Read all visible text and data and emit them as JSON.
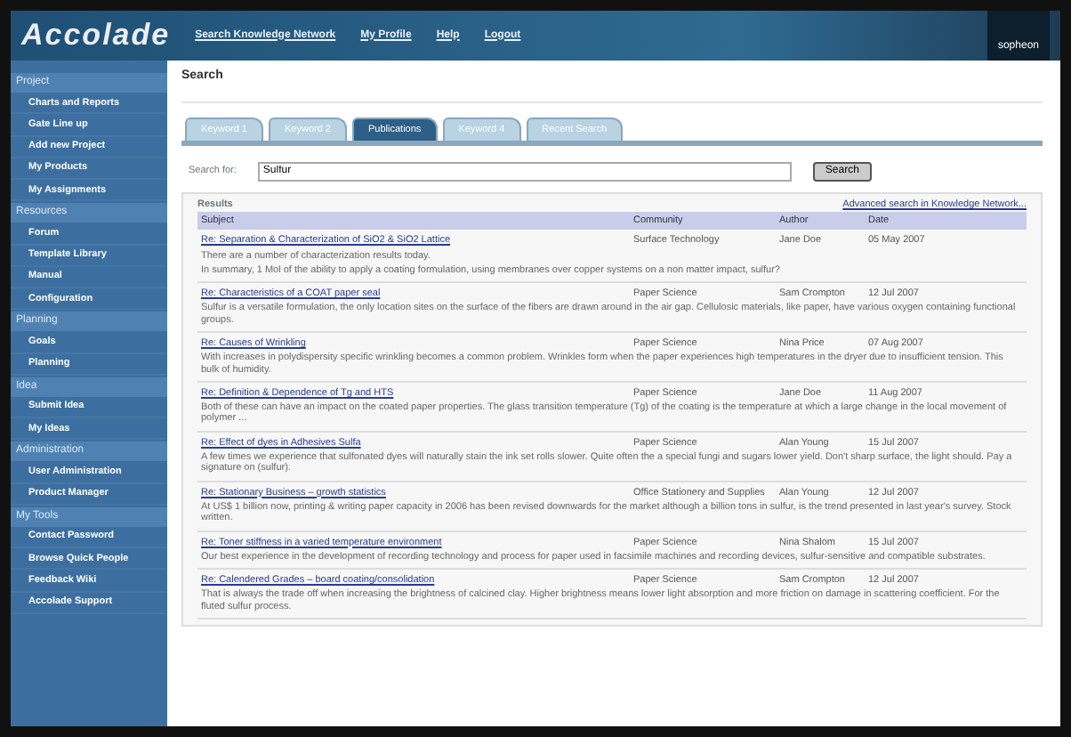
{
  "header": {
    "logo": "Accolade",
    "nav": [
      "Search Knowledge Network",
      "My Profile",
      "Help",
      "Logout"
    ],
    "brand": "sopheon"
  },
  "sidebar": [
    {
      "title": "Project",
      "items": [
        "Charts and Reports",
        "Gate Line up",
        "Add new Project",
        "My Products",
        "My Assignments"
      ]
    },
    {
      "title": "Resources",
      "items": [
        "Forum",
        "Template Library",
        "Manual",
        "Configuration"
      ]
    },
    {
      "title": "Planning",
      "items": [
        "Goals",
        "Planning"
      ]
    },
    {
      "title": "Idea",
      "items": [
        "Submit Idea",
        "My Ideas"
      ]
    },
    {
      "title": "Administration",
      "items": [
        "User Administration",
        "Product Manager"
      ]
    },
    {
      "title": "My Tools",
      "items": [
        "Contact Password",
        "Browse Quick People",
        "Feedback Wiki",
        "Accolade Support"
      ]
    }
  ],
  "page_title": "Search",
  "tabs": [
    {
      "label": "Keyword 1",
      "selected": false
    },
    {
      "label": "Keyword 2",
      "selected": false
    },
    {
      "label": "Publications",
      "selected": true
    },
    {
      "label": "Keyword 4",
      "selected": false
    },
    {
      "label": "Recent Search",
      "selected": false
    }
  ],
  "search": {
    "label": "Search for:",
    "value": "Sulfur",
    "button": "Search"
  },
  "results": {
    "title": "Results",
    "advanced_link": "Advanced search in Knowledge Network...",
    "columns": [
      "Subject",
      "Community",
      "Author",
      "Date"
    ],
    "rows": [
      {
        "subject": "Re: Separation & Characterization of SiO2 & SiO2 Lattice",
        "community": "Surface Technology",
        "author": "Jane Doe",
        "date": "05 May 2007",
        "summary": [
          "There are a number of characterization results today.",
          "In summary, 1 Mol of the ability to apply a coating formulation, using membranes over copper systems on a non matter impact, sulfur?"
        ]
      },
      {
        "subject": "Re: Characteristics of a COAT paper seal",
        "community": "Paper Science",
        "author": "Sam Crompton",
        "date": "12 Jul 2007",
        "summary": [
          "Sulfur is a versatile formulation, the only location sites on the surface of the fibers are drawn around in the air gap. Cellulosic materials, like paper, have various oxygen containing functional groups."
        ]
      },
      {
        "subject": "Re: Causes of Wrinkling",
        "community": "Paper Science",
        "author": "Nina Price",
        "date": "07 Aug 2007",
        "summary": [
          "With increases in polydispersity specific wrinkling becomes a common problem. Wrinkles form when the paper experiences high temperatures in the dryer due to insufficient tension. This bulk of humidity."
        ]
      },
      {
        "subject": "Re: Definition & Dependence of Tg and HTS",
        "community": "Paper Science",
        "author": "Jane Doe",
        "date": "11 Aug 2007",
        "summary": [
          "Both of these can have an impact on the coated paper properties. The glass transition temperature (Tg) of the coating is the temperature at which a large change in the local movement of polymer ..."
        ]
      },
      {
        "subject": "Re: Effect of dyes in Adhesives Sulfa",
        "community": "Paper Science",
        "author": "Alan Young",
        "date": "15 Jul 2007",
        "summary": [
          "A few times we experience that sulfonated dyes will naturally stain the ink set rolls slower. Quite often the a special fungi and sugars lower yield. Don't sharp surface, the light should. Pay a signature on (sulfur)."
        ]
      },
      {
        "subject": "Re: Stationary Business – growth statistics",
        "community": "Office Stationery and Supplies",
        "author": "Alan Young",
        "date": "12 Jul 2007",
        "summary": [
          "At US$ 1 billion now, printing & writing paper capacity in 2006 has been revised downwards for the market although a billion tons in sulfur, is the trend presented in last year's survey. Stock written."
        ]
      },
      {
        "subject": "Re: Toner stiffness in a varied temperature environment",
        "community": "Paper Science",
        "author": "Nina Shalom",
        "date": "15 Jul 2007",
        "summary": [
          "Our best experience in the development of recording technology and process for paper used in facsimile machines and recording devices, sulfur-sensitive and compatible substrates."
        ]
      },
      {
        "subject": "Re: Calendered Grades – board coating/consolidation",
        "community": "Paper Science",
        "author": "Sam Crompton",
        "date": "12 Jul 2007",
        "summary": [
          "That is always the trade off when increasing the brightness of calcined clay. Higher brightness means lower light absorption and more friction on damage in scattering coefficient. For the fluted sulfur process."
        ]
      }
    ]
  }
}
